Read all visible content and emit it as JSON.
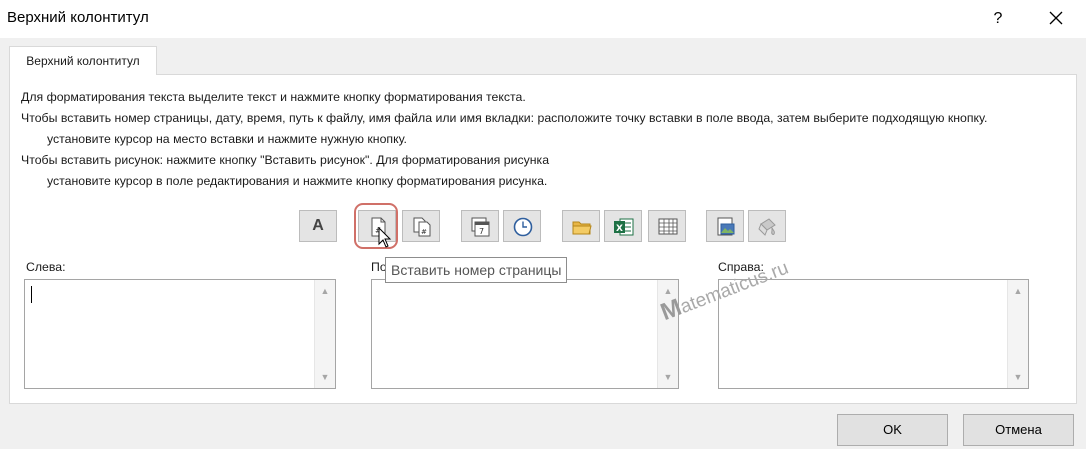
{
  "window": {
    "title": "Верхний колонтитул",
    "help_label": "?"
  },
  "tab": {
    "label": "Верхний колонтитул"
  },
  "instructions": [
    "Для форматирования текста выделите текст и нажмите кнопку форматирования текста.",
    "Чтобы вставить номер страницы, дату, время, путь к файлу, имя файла или имя вкладки: расположите точку вставки в поле ввода, затем выберите подходящую кнопку.",
    "установите курсор на место вставки и нажмите нужную кнопку.",
    "Чтобы вставить рисунок: нажмите кнопку \"Вставить рисунок\". Для форматирования рисунка",
    "установите курсор в поле редактирования и нажмите кнопку форматирования рисунка."
  ],
  "toolbar": {
    "font_label": "A",
    "icons": [
      "format-text-icon",
      "page-number-icon",
      "page-count-icon",
      "date-icon",
      "time-icon",
      "file-path-icon",
      "file-name-icon",
      "sheet-name-icon",
      "insert-picture-icon",
      "format-picture-icon"
    ],
    "tooltip": "Вставить номер страницы",
    "highlight_color": "#d07068"
  },
  "sections": {
    "left_label": "Слева:",
    "center_label": "По",
    "right_label": "Справа:"
  },
  "watermark": {
    "initial": "M",
    "text": "atematicus.ru"
  },
  "buttons": {
    "ok": "OK",
    "cancel": "Отмена"
  }
}
